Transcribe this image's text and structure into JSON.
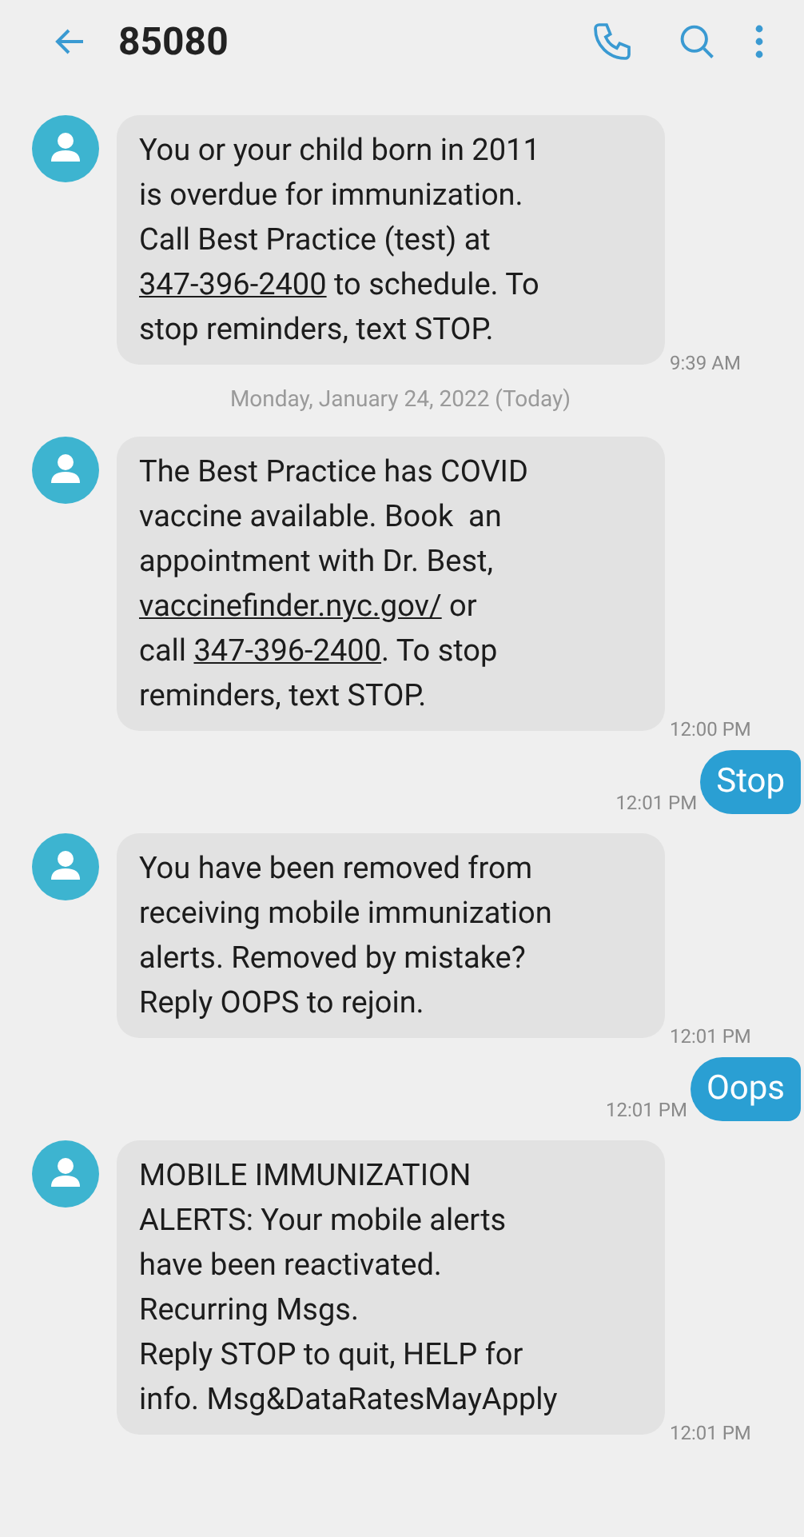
{
  "header": {
    "title": "85080"
  },
  "messages": [
    {
      "kind": "incoming",
      "time": "9:39 AM",
      "lines": [
        [
          {
            "text": "You or your child born in 2011",
            "link": false
          }
        ],
        [
          {
            "text": "is overdue for immunization.",
            "link": false
          }
        ],
        [
          {
            "text": "Call Best Practice (test) at",
            "link": false
          }
        ],
        [
          {
            "text": "347-396-2400",
            "link": true
          },
          {
            "text": " to schedule. To",
            "link": false
          }
        ],
        [
          {
            "text": "stop reminders, text STOP.",
            "link": false
          }
        ]
      ]
    },
    {
      "kind": "date",
      "text": "Monday, January 24, 2022 (Today)"
    },
    {
      "kind": "incoming",
      "time": "12:00 PM",
      "lines": [
        [
          {
            "text": "The Best Practice has COVID",
            "link": false
          }
        ],
        [
          {
            "text": "vaccine available. Book  an",
            "link": false
          }
        ],
        [
          {
            "text": "appointment with Dr. Best,",
            "link": false
          }
        ],
        [
          {
            "text": "vaccinefinder.nyc.gov/",
            "link": true
          },
          {
            "text": " or",
            "link": false
          }
        ],
        [
          {
            "text": "call ",
            "link": false
          },
          {
            "text": "347-396-2400",
            "link": true
          },
          {
            "text": ". To stop",
            "link": false
          }
        ],
        [
          {
            "text": "reminders, text STOP.",
            "link": false
          }
        ]
      ]
    },
    {
      "kind": "outgoing",
      "time": "12:01 PM",
      "text": "Stop"
    },
    {
      "kind": "incoming",
      "time": "12:01 PM",
      "lines": [
        [
          {
            "text": "You have been removed from",
            "link": false
          }
        ],
        [
          {
            "text": "receiving mobile immunization",
            "link": false
          }
        ],
        [
          {
            "text": "alerts. Removed by mistake?",
            "link": false
          }
        ],
        [
          {
            "text": "Reply OOPS to rejoin.",
            "link": false
          }
        ]
      ]
    },
    {
      "kind": "outgoing",
      "time": "12:01 PM",
      "text": "Oops"
    },
    {
      "kind": "incoming",
      "time": "12:01 PM",
      "lines": [
        [
          {
            "text": "MOBILE IMMUNIZATION",
            "link": false
          }
        ],
        [
          {
            "text": "ALERTS: Your mobile alerts",
            "link": false
          }
        ],
        [
          {
            "text": "have been reactivated.",
            "link": false
          }
        ],
        [
          {
            "text": "Recurring Msgs.",
            "link": false
          }
        ],
        [
          {
            "text": "Reply STOP to quit, HELP for",
            "link": false
          }
        ],
        [
          {
            "text": "info. Msg&DataRatesMayApply",
            "link": false
          }
        ]
      ]
    }
  ]
}
